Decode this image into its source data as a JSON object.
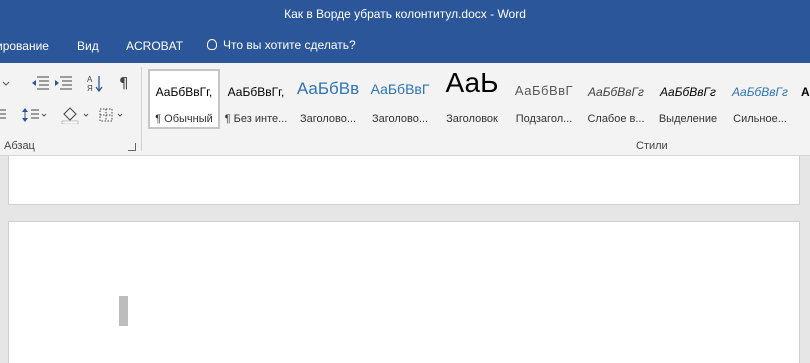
{
  "window": {
    "title": "Как в Ворде убрать колонтитул.docx - Word"
  },
  "tabs": [
    {
      "label": "ирование"
    },
    {
      "label": "Вид"
    },
    {
      "label": "ACROBAT"
    }
  ],
  "tell_me": {
    "placeholder": "Что вы хотите сделать?"
  },
  "paragraph_group": {
    "label": "Абзац"
  },
  "styles_group": {
    "label": "Стили",
    "items": [
      {
        "sample": "АаБбВвГг,",
        "name": "¶ Обычный",
        "selected": true
      },
      {
        "sample": "АаБбВвГг,",
        "name": "¶ Без инте..."
      },
      {
        "sample": "АаБбВв",
        "name": "Заголово..."
      },
      {
        "sample": "АаБбВвГ",
        "name": "Заголово..."
      },
      {
        "sample": "АаЬ",
        "name": "Заголовок"
      },
      {
        "sample": "АаБбВвГ",
        "name": "Подзагол..."
      },
      {
        "sample": "АаБбВвГг",
        "name": "Слабое в..."
      },
      {
        "sample": "АаБбВвГг",
        "name": "Выделение"
      },
      {
        "sample": "АаБбВвГг",
        "name": "Сильное..."
      },
      {
        "sample": "А"
      }
    ]
  },
  "colors": {
    "titlebar": "#2b579a",
    "ribbon": "#f3f3f3",
    "heading_blue": "#2e74b5"
  }
}
